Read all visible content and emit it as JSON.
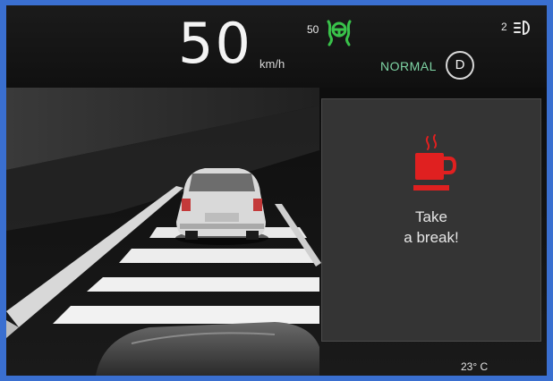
{
  "dashboard": {
    "speed": "50",
    "speed_unit": "km/h",
    "speed_limit": "50",
    "drive_mode": "NORMAL",
    "gear": "D",
    "assist_level": "2",
    "outside_temp": "23° C"
  },
  "alert": {
    "line1": "Take",
    "line2": "a break!",
    "icon": "coffee-cup-icon",
    "icon_color": "#e02020"
  },
  "colors": {
    "mode_text": "#7ed4a4",
    "steering_assist": "#39c24a",
    "background": "#121212",
    "frame": "#3a6fd0"
  }
}
